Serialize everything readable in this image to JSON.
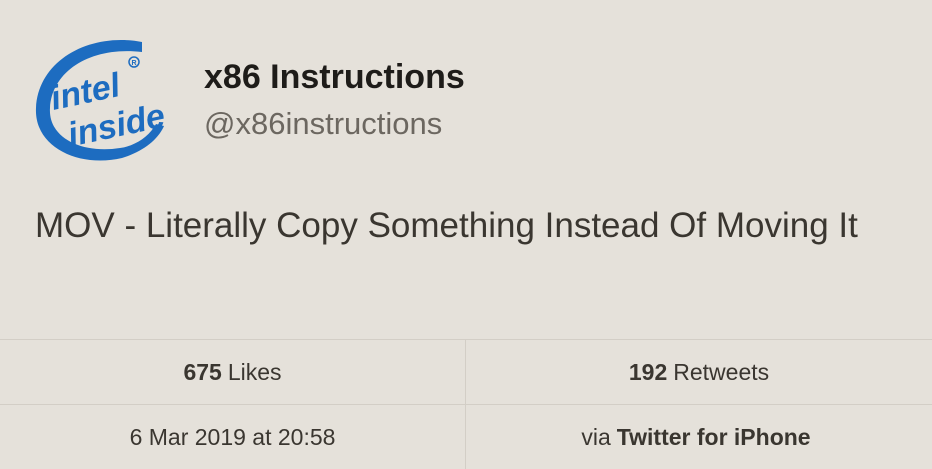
{
  "profile": {
    "avatar_text_line1": "intel",
    "avatar_text_line2": "inside",
    "avatar_brand_color": "#1d6cc0",
    "name": "x86 Instructions",
    "handle": "@x86instructions"
  },
  "tweet": {
    "text": "MOV - Literally Copy Something Instead Of Moving It"
  },
  "stats": {
    "likes_count": "675",
    "likes_label": "Likes",
    "retweets_count": "192",
    "retweets_label": "Retweets",
    "timestamp": "6 Mar 2019 at 20:58",
    "via_label": "via",
    "source": "Twitter for iPhone"
  },
  "colors": {
    "background": "#e5e1da",
    "divider": "#d3cec6",
    "name_text": "#1e1c19",
    "handle_text": "#6c6760"
  }
}
